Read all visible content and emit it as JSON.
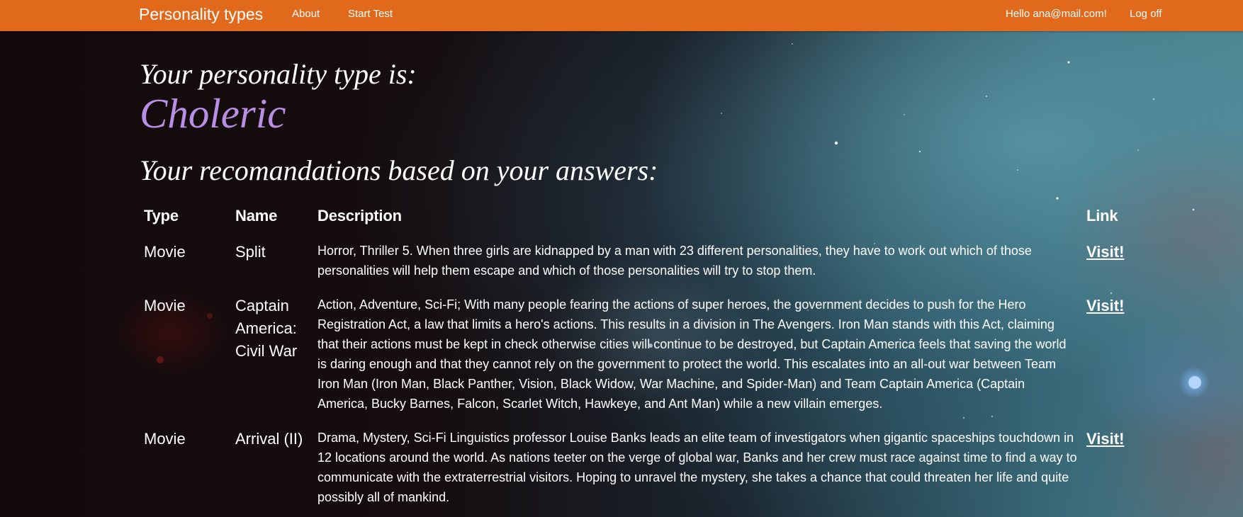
{
  "nav": {
    "brand": "Personality types",
    "about": "About",
    "start_test": "Start Test",
    "greeting": "Hello ana@mail.com!",
    "log_off": "Log off",
    "background_color": "#e0691c"
  },
  "result": {
    "heading": "Your personality type is:",
    "type_name": "Choleric",
    "type_color": "#b98ee5",
    "recommendations_heading": "Your recomandations based on your answers:"
  },
  "table": {
    "headers": {
      "type": "Type",
      "name": "Name",
      "description": "Description",
      "link": "Link"
    },
    "rows": [
      {
        "type": "Movie",
        "name": "Split",
        "description": "Horror, Thriller 5. When three girls are kidnapped by a man with 23 different personalities, they have to work out which of those personalities will help them escape and which of those personalities will try to stop them.",
        "link": "Visit!"
      },
      {
        "type": "Movie",
        "name": "Captain America: Civil War",
        "description": "Action, Adventure, Sci-Fi; With many people fearing the actions of super heroes, the government decides to push for the Hero Registration Act, a law that limits a hero's actions. This results in a division in The Avengers. Iron Man stands with this Act, claiming that their actions must be kept in check otherwise cities will continue to be destroyed, but Captain America feels that saving the world is daring enough and that they cannot rely on the government to protect the world. This escalates into an all-out war between Team Iron Man (Iron Man, Black Panther, Vision, Black Widow, War Machine, and Spider-Man) and Team Captain America (Captain America, Bucky Barnes, Falcon, Scarlet Witch, Hawkeye, and Ant Man) while a new villain emerges.",
        "link": "Visit!"
      },
      {
        "type": "Movie",
        "name": "Arrival (II)",
        "description": "Drama, Mystery, Sci-Fi Linguistics professor Louise Banks leads an elite team of investigators when gigantic spaceships touchdown in 12 locations around the world. As nations teeter on the verge of global war, Banks and her crew must race against time to find a way to communicate with the extraterrestrial visitors. Hoping to unravel the mystery, she takes a chance that could threaten her life and quite possibly all of mankind.",
        "link": "Visit!"
      }
    ]
  }
}
